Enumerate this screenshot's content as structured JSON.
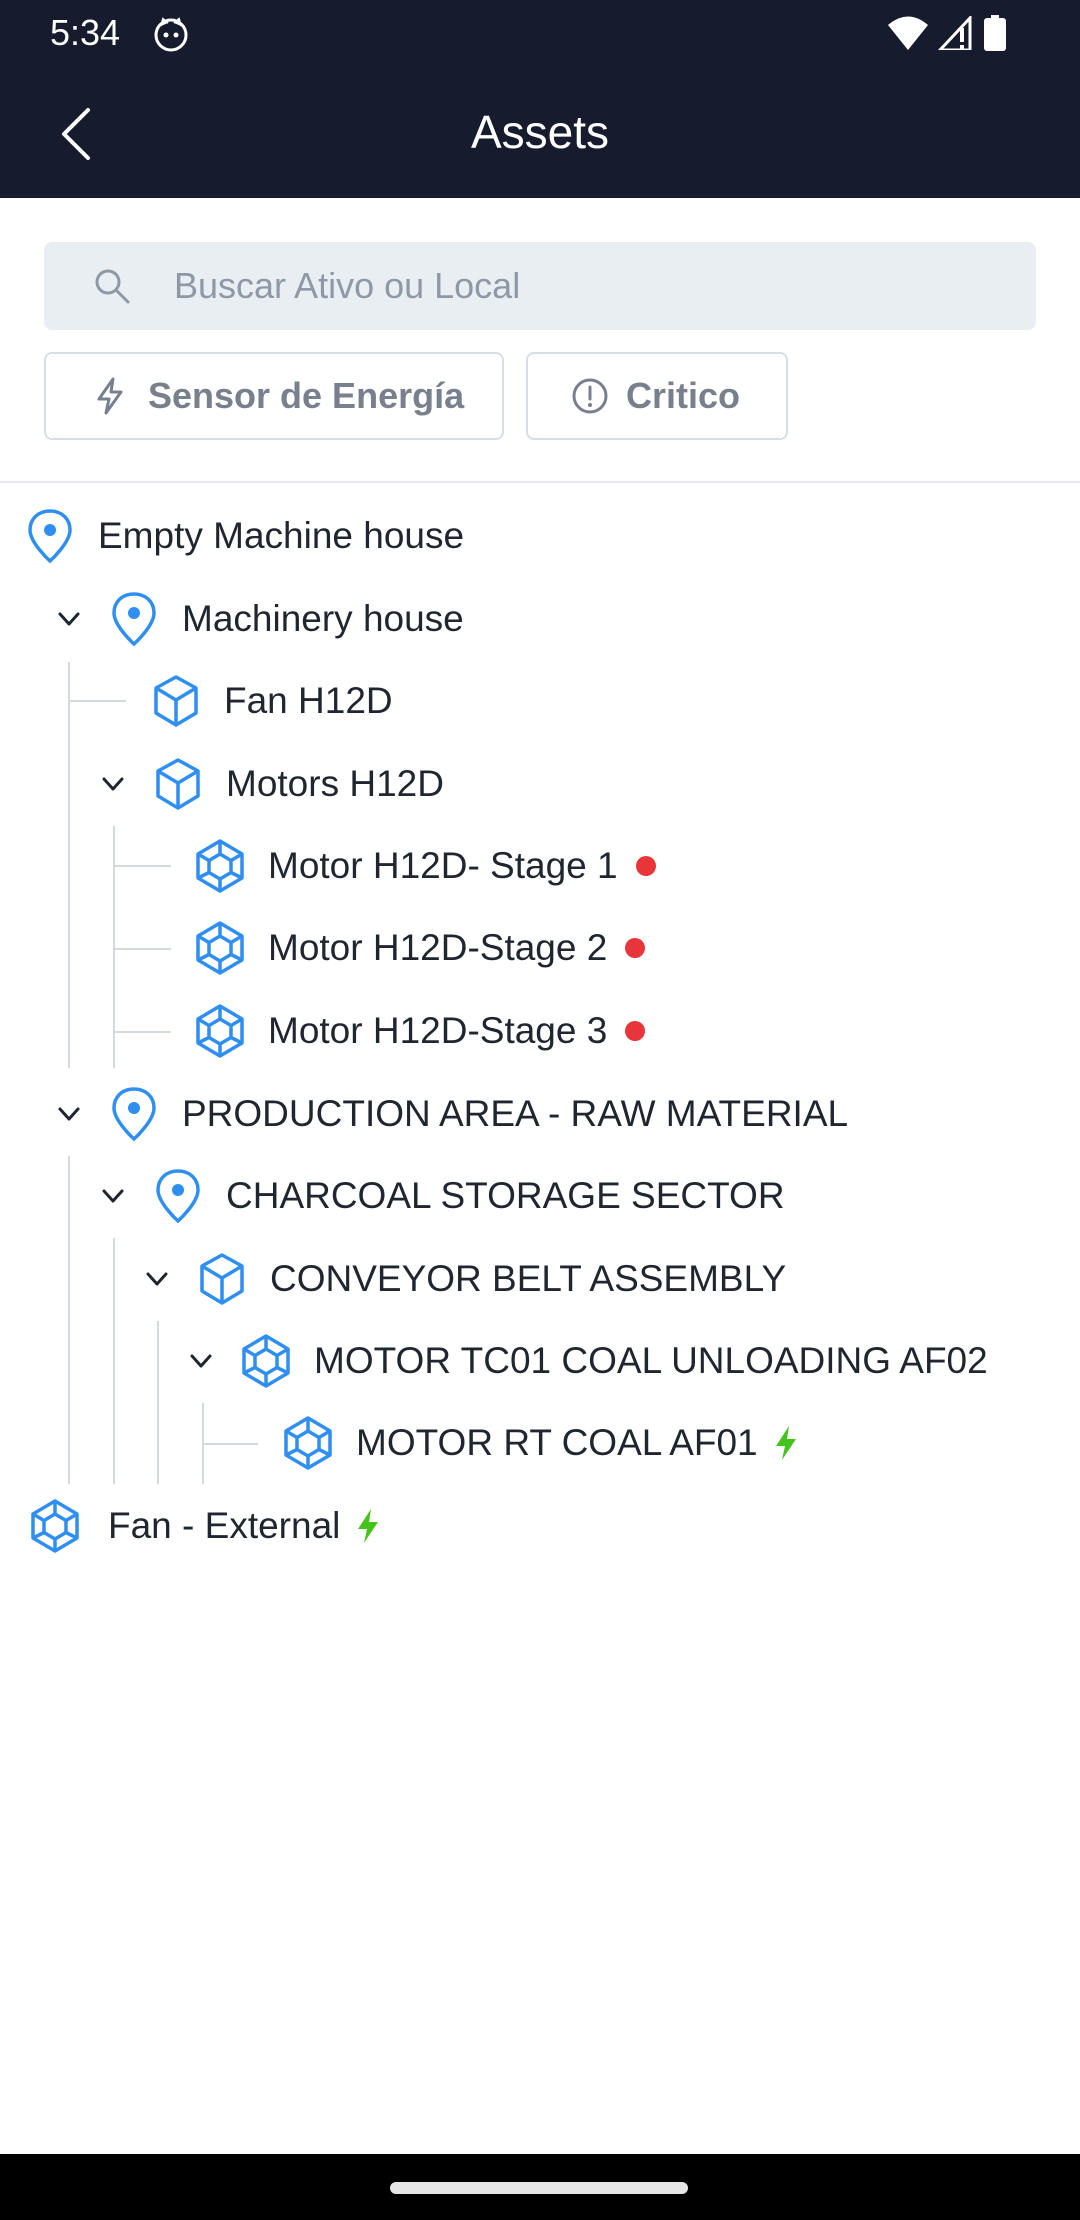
{
  "status_bar": {
    "time": "5:34",
    "icons": [
      "cat-face-icon",
      "wifi-icon",
      "signal-icon",
      "battery-icon"
    ]
  },
  "app_bar": {
    "title": "Assets",
    "back_icon": "chevron-left-icon"
  },
  "search": {
    "placeholder": "Buscar Ativo ou Local",
    "value": ""
  },
  "filters": [
    {
      "label": "Sensor de Energía",
      "icon": "bolt-icon"
    },
    {
      "label": "Critico",
      "icon": "alert-circle-icon"
    }
  ],
  "colors": {
    "header_bg": "#161b2e",
    "accent_blue": "#2f8ff0",
    "alert_red": "#e8353a",
    "energy_green": "#46c21c"
  },
  "tree": [
    {
      "label": "Empty Machine house",
      "type": "location",
      "expanded": false,
      "status": "none"
    },
    {
      "label": "Machinery house",
      "type": "location",
      "expanded": true,
      "status": "none"
    },
    {
      "label": "Fan H12D",
      "type": "asset",
      "status": "none"
    },
    {
      "label": "Motors H12D",
      "type": "asset",
      "expanded": true,
      "status": "none"
    },
    {
      "label": "Motor H12D- Stage 1",
      "type": "component",
      "status": "critical"
    },
    {
      "label": "Motor H12D-Stage 2",
      "type": "component",
      "status": "critical"
    },
    {
      "label": "Motor H12D-Stage 3",
      "type": "component",
      "status": "critical"
    },
    {
      "label": "PRODUCTION AREA - RAW MATERIAL",
      "type": "location",
      "expanded": true,
      "status": "none"
    },
    {
      "label": "CHARCOAL STORAGE SECTOR",
      "type": "location",
      "expanded": true,
      "status": "none"
    },
    {
      "label": "CONVEYOR BELT ASSEMBLY",
      "type": "asset",
      "expanded": true,
      "status": "none"
    },
    {
      "label": "MOTOR TC01 COAL UNLOADING AF02",
      "type": "component",
      "expanded": true,
      "status": "none"
    },
    {
      "label": "MOTOR RT COAL AF01",
      "type": "component",
      "status": "energy"
    },
    {
      "label": "Fan - External",
      "type": "component",
      "status": "energy"
    }
  ]
}
